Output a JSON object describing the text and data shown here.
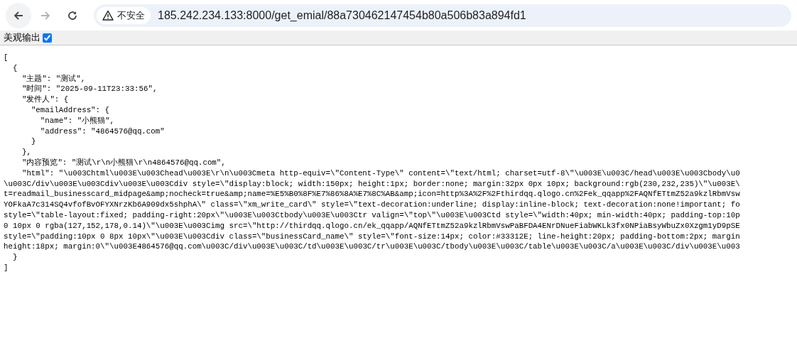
{
  "browser": {
    "nav_buttons": [
      {
        "kind": "back",
        "disabled": false
      },
      {
        "kind": "forward",
        "disabled": true
      },
      {
        "kind": "reload",
        "disabled": false
      }
    ],
    "security_label": "不安全",
    "url": "185.242.234.133:8000/get_emial/88a730462147454b80a506b83a894fd1"
  },
  "options": {
    "pretty_print": {
      "label": "美观输出",
      "checked": true
    }
  },
  "json_lines": [
    {
      "text": "[",
      "children": [
        {
          "text": "{",
          "children": [
            {
              "text": "\"主题\": \"测试\","
            },
            {
              "text": "\"时间\": \"2025-09-11T23:33:56\","
            },
            {
              "text": "\"发件人\": {",
              "children": [
                {
                  "text": "\"emailAddress\": {",
                  "children": [
                    {
                      "text": "\"name\": \"小熊猫\","
                    },
                    {
                      "text": "\"address\": \"4864576@qq.com\""
                    }
                  ]
                },
                {
                  "text": "}"
                }
              ]
            },
            {
              "text": "},"
            },
            {
              "text": "\"内容预览\": \"测试\\r\\n小熊猫\\r\\n4864576@qq.com\","
            },
            {
              "text": "\"html\": \"\\u003Chtml\\u003E\\u003Chead\\u003E\\r\\n\\u003Cmeta http-equiv=\\\"Content-Type\\\" content=\\\"text/html; charset=utf-8\\\"\\u003E\\u003C/head\\u003E\\u003Cbody\\u0",
              "wrapped_lines": [
                "\\u003C/div\\u003E\\u003Cdiv\\u003E\\u003Cdiv style=\\\"display:block; width:150px; height:1px; border:none; margin:32px 0px 10px; background:rgb(230,232,235)\\\"\\u003E\\",
                "t=readmail_businesscard_midpage&amp;nocheck=true&amp;name=%E5%B0%8F%E7%86%8A%E7%8C%AB&amp;icon=http%3A%2F%2Fthirdqq.qlogo.cn%2Fek_qqapp%2FAQNfETtmZ52a9kzlRbmVsw",
                "YOFkaA7c314SQ4vfofBvOFYXNrzKb6A909dx5shphA\\\" class=\\\"xm_write_card\\\" style=\\\"text-decoration:underline; display:inline-block; text-decoration:none!important; fo",
                "style=\\\"table-layout:fixed; padding-right:20px\\\"\\u003E\\u003Ctbody\\u003E\\u003Ctr valign=\\\"top\\\"\\u003E\\u003Ctd style=\\\"width:40px; min-width:40px; padding-top:10p",
                "0 10px 0 rgba(127,152,178,0.14)\\\"\\u003E\\u003Cimg src=\\\"http://thirdqq.qlogo.cn/ek_qqapp/AQNfETtmZ52a9kzlRbmVswPaBFDA4ENrDNueFiabWKLk3fx0NPiaBsyWbuZx0Xzgm1yD9pSE",
                "style=\\\"padding:10px 0 8px 10px\\\"\\u003E\\u003Cdiv class=\\\"businessCard_name\\\" style=\\\"font-size:14px; color:#33312E; line-height:20px; padding-bottom:2px; margin",
                "height:18px; margin:0\\\"\\u003E4864576@qq.com\\u003C/div\\u003E\\u003C/td\\u003E\\u003C/tr\\u003E\\u003C/tbody\\u003E\\u003C/table\\u003E\\u003C/a\\u003E\\u003C/div\\u003E\\u003"
              ]
            }
          ]
        },
        {
          "text": "}"
        }
      ]
    },
    {
      "text": "]"
    }
  ]
}
